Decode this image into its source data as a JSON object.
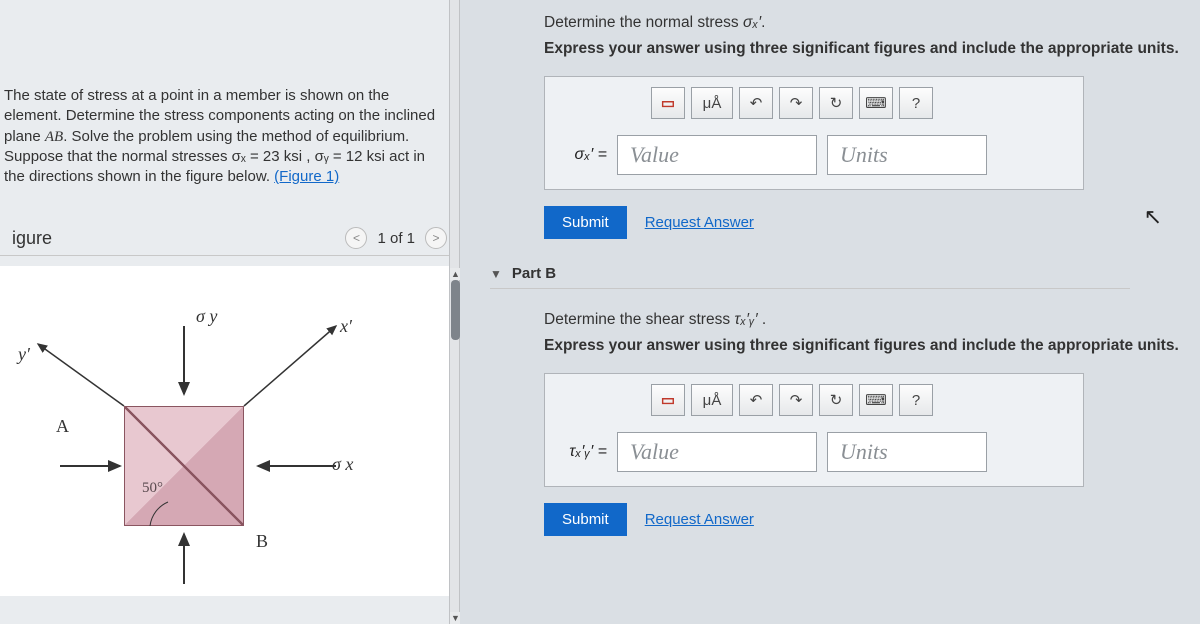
{
  "problem": {
    "text_before": "The state of stress at a point in a member is shown on the element. Determine the stress components acting on the inclined plane ",
    "plane": "AB",
    "text_mid": ". Solve the problem using the method of equilibrium. Suppose that the normal stresses ",
    "sx": "σₓ = 23 ksi",
    "sep": " , ",
    "sy": "σᵧ = 12 ksi",
    "text_after": " act in the directions shown in the figure below. ",
    "figure_link": "(Figure 1)"
  },
  "figure": {
    "header": "igure",
    "nav_label": "1 of 1",
    "labels": {
      "sy": "σ y",
      "sx": "σ x",
      "yprime": "y′",
      "xprime": "x′",
      "A": "A",
      "B": "B",
      "angle": "50°"
    }
  },
  "partA": {
    "prompt1_pre": "Determine the normal stress ",
    "prompt1_var": "σₓ′",
    "prompt1_post": ".",
    "prompt2": "Express your answer using three significant figures and include the appropriate units.",
    "var_label": "σₓ′ =",
    "value_ph": "Value",
    "units_ph": "Units",
    "submit": "Submit",
    "request": "Request Answer"
  },
  "partB": {
    "header": "Part B",
    "prompt1_pre": "Determine the shear stress ",
    "prompt1_var": "τₓ′ᵧ′",
    "prompt1_post": " .",
    "prompt2": "Express your answer using three significant figures and include the appropriate units.",
    "var_label": "τₓ′ᵧ′ =",
    "value_ph": "Value",
    "units_ph": "Units",
    "submit": "Submit",
    "request": "Request Answer"
  },
  "toolbar": {
    "templates": "▭",
    "mu": "μÅ",
    "undo": "↶",
    "redo": "↷",
    "reset": "↻",
    "keyboard": "⌨",
    "help": "?"
  }
}
